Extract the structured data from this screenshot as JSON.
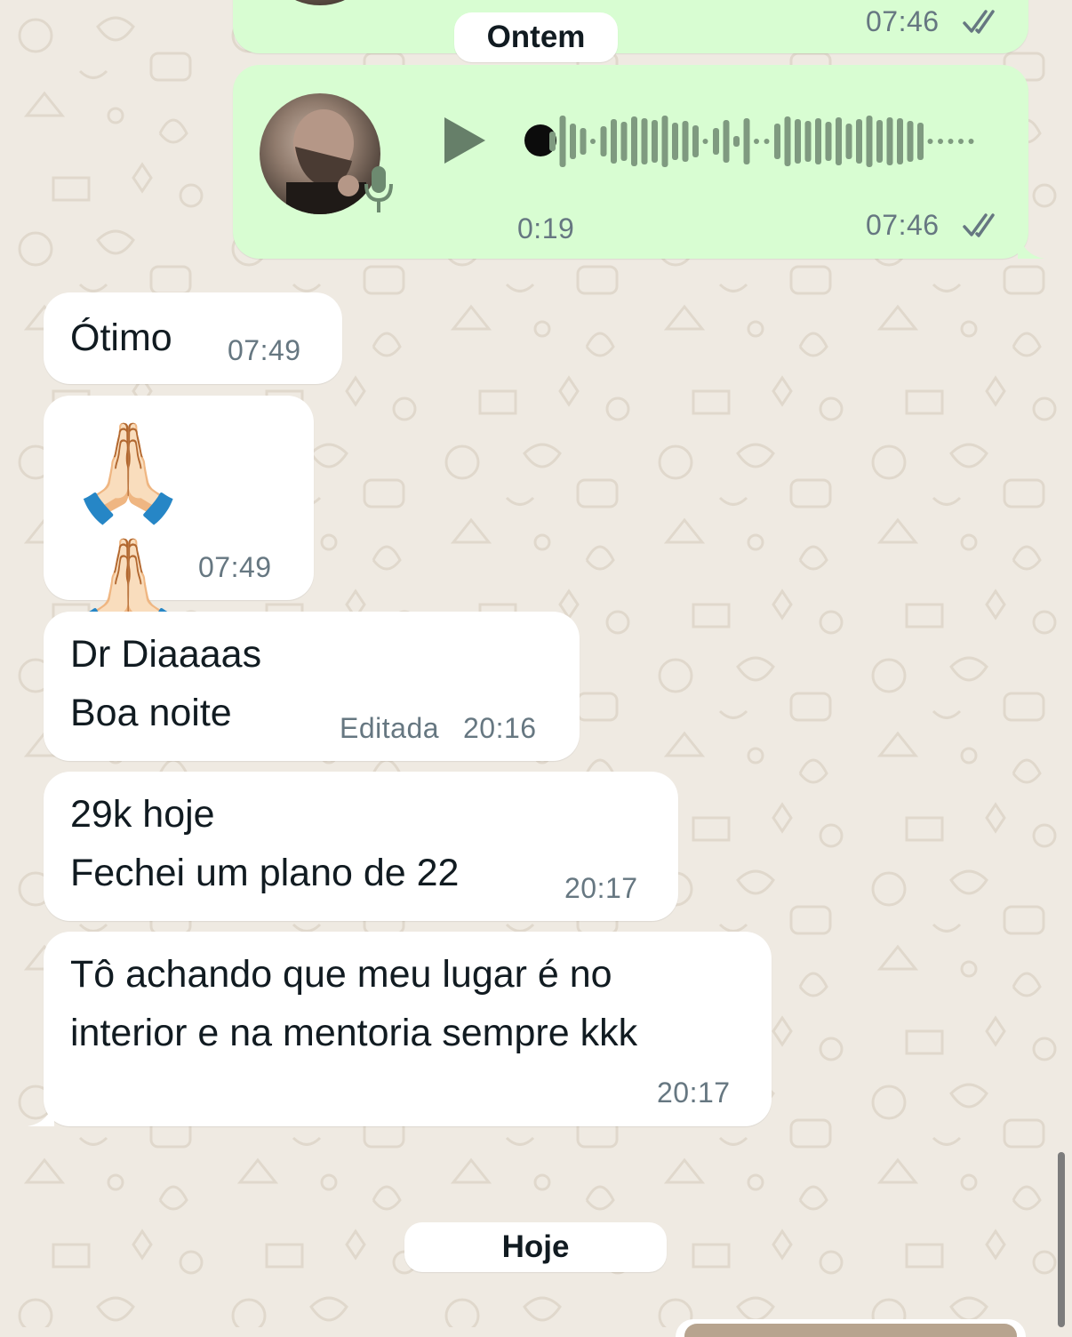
{
  "chat": {
    "date_separators": {
      "yesterday": "Ontem",
      "today": "Hoje"
    },
    "voice_messages": [
      {
        "sent_time": "07:46",
        "status": "read",
        "partial": true
      },
      {
        "duration": "0:19",
        "sent_time": "07:46",
        "status": "read"
      }
    ],
    "messages": [
      {
        "text": "Ótimo",
        "time": "07:49"
      },
      {
        "text": "🙏🏻🙏🏻",
        "time": "07:49"
      },
      {
        "line1": "Dr Diaaaas",
        "line2": "Boa noite",
        "edited_label": "Editada",
        "time": "20:16"
      },
      {
        "line1": "29k hoje",
        "line2": "Fechei um plano de 22",
        "time": "20:17"
      },
      {
        "line1": "Tô achando que meu lugar é no",
        "line2": "interior e na mentoria sempre kkk",
        "time": "20:17"
      }
    ]
  },
  "colors": {
    "wallpaper": "#efeae2",
    "incoming_bubble": "#ffffff",
    "outgoing_bubble": "#d8fdd2",
    "timestamp": "#667781",
    "read_ticks": "#667781",
    "waveform": "#7f9a80",
    "play_icon": "#667f69"
  },
  "icons": [
    "play-icon",
    "microphone-icon",
    "double-check-icon"
  ]
}
